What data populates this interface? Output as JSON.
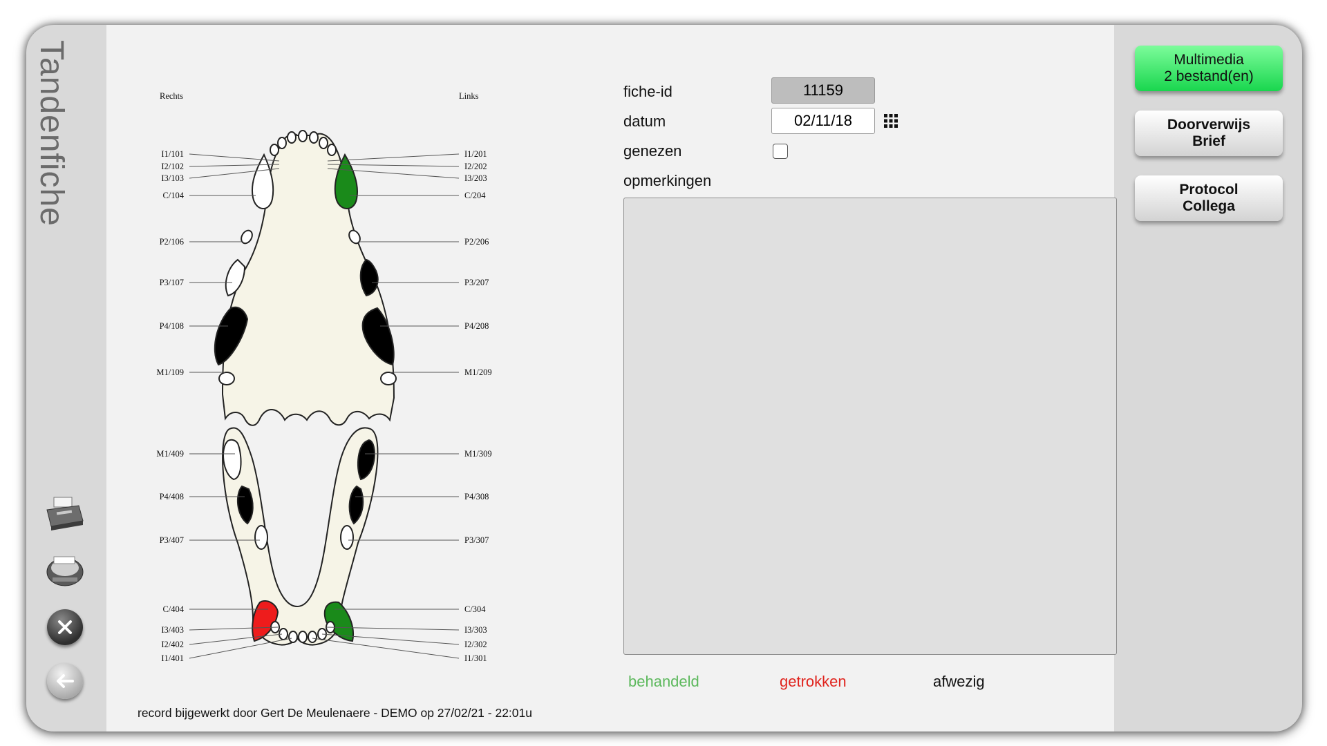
{
  "title": "Tandenfiche",
  "form": {
    "fiche_id_label": "fiche-id",
    "fiche_id_value": "11159",
    "datum_label": "datum",
    "datum_value": "02/11/18",
    "genezen_label": "genezen",
    "genezen_checked": false,
    "opmerkingen_label": "opmerkingen",
    "opmerkingen_value": ""
  },
  "legend": {
    "behandeld": "behandeld",
    "behandeld_color": "#5cb85c",
    "getrokken": "getrokken",
    "getrokken_color": "#e0231d",
    "afwezig": "afwezig",
    "afwezig_color": "#111111"
  },
  "footer": "record bijgewerkt door Gert De Meulenaere - DEMO op 27/02/21 - 22:01u",
  "buttons": {
    "multimedia_line1": "Multimedia",
    "multimedia_line2": "2 bestand(en)",
    "doorverwijs_line1": "Doorverwijs",
    "doorverwijs_line2": "Brief",
    "protocol_line1": "Protocol",
    "protocol_line2": "Collega"
  },
  "rail_icons": [
    "printer-icon",
    "scanner-icon",
    "close-icon",
    "back-arrow-icon"
  ],
  "chart": {
    "side_right": "Rechts",
    "side_left": "Links",
    "upper_right_labels": [
      "I1/101",
      "I2/102",
      "I3/103",
      "C/104",
      "P2/106",
      "P3/107",
      "P4/108",
      "M1/109"
    ],
    "upper_left_labels": [
      "I1/201",
      "I2/202",
      "I3/203",
      "C/204",
      "P2/206",
      "P3/207",
      "P4/208",
      "M1/209"
    ],
    "lower_right_labels": [
      "M1/409",
      "P4/408",
      "P3/407",
      "C/404",
      "I3/403",
      "I2/402",
      "I1/401"
    ],
    "lower_left_labels": [
      "M1/309",
      "P4/308",
      "P3/307",
      "C/304",
      "I3/303",
      "I2/302",
      "I1/301"
    ],
    "status_colors": {
      "treated": "#1a8a1a",
      "extracted": "#ee1c1c",
      "absent": "#000000",
      "normal": "#ffffff"
    }
  }
}
